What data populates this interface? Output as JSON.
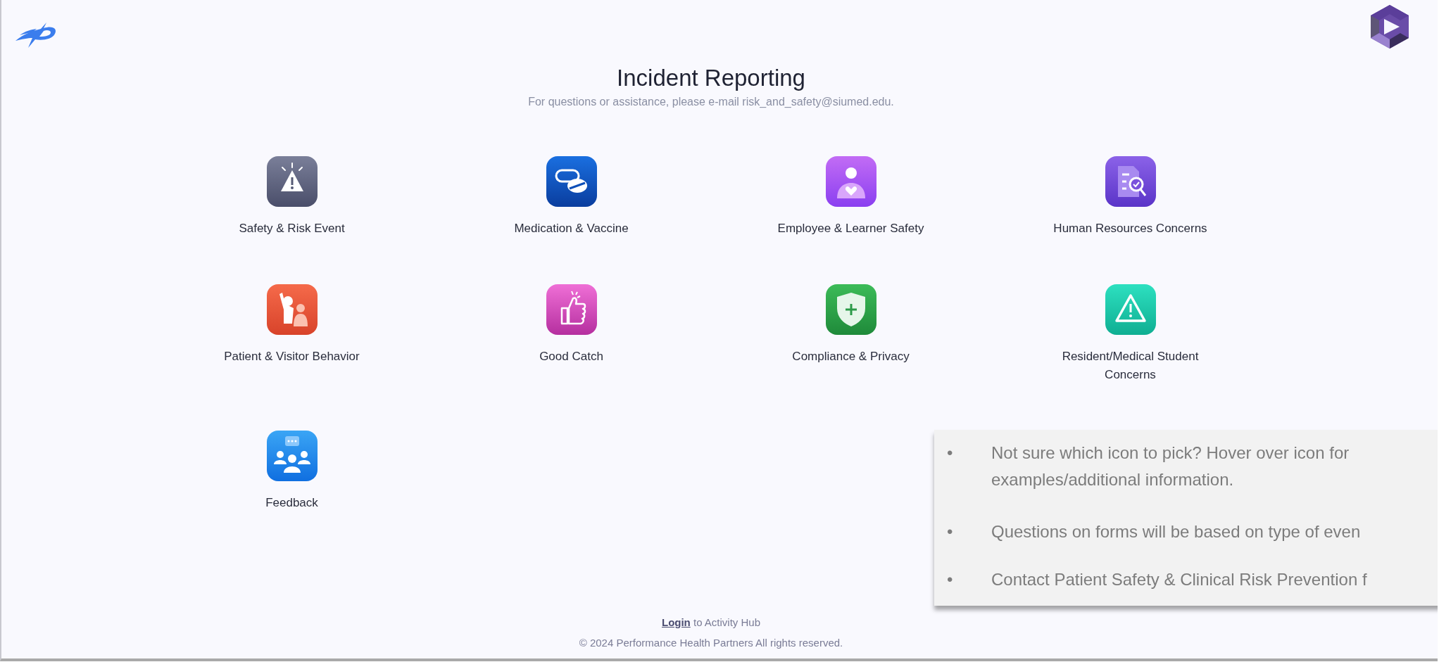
{
  "header": {
    "title": "Incident Reporting",
    "subtitle": "For questions or assistance, please e-mail risk_and_safety@siumed.edu."
  },
  "categories": [
    {
      "label": "Safety & Risk Event",
      "kind": "warning"
    },
    {
      "label": "Medication & Vaccine",
      "kind": "pills"
    },
    {
      "label": "Employee & Learner Safety",
      "kind": "person"
    },
    {
      "label": "Human Resources Concerns",
      "kind": "document"
    },
    {
      "label": "Patient & Visitor Behavior",
      "kind": "conflict"
    },
    {
      "label": "Good Catch",
      "kind": "thumbs"
    },
    {
      "label": "Compliance & Privacy",
      "kind": "shield"
    },
    {
      "label": "Resident/Medical Student Concerns",
      "kind": "alert"
    },
    {
      "label": "Feedback",
      "kind": "people"
    }
  ],
  "callout": [
    {
      "bullet": "•",
      "text": "Not sure which icon to pick? Hover over icon for examples/additional information."
    },
    {
      "bullet": "•",
      "text": "Questions on forms will be based on type of even"
    },
    {
      "bullet": "•",
      "text": "Contact Patient Safety & Clinical Risk Prevention f"
    }
  ],
  "footer": {
    "login_link": "Login",
    "login_text": "to Activity Hub",
    "copyright": "© 2024 Performance Health Partners All rights reserved."
  }
}
